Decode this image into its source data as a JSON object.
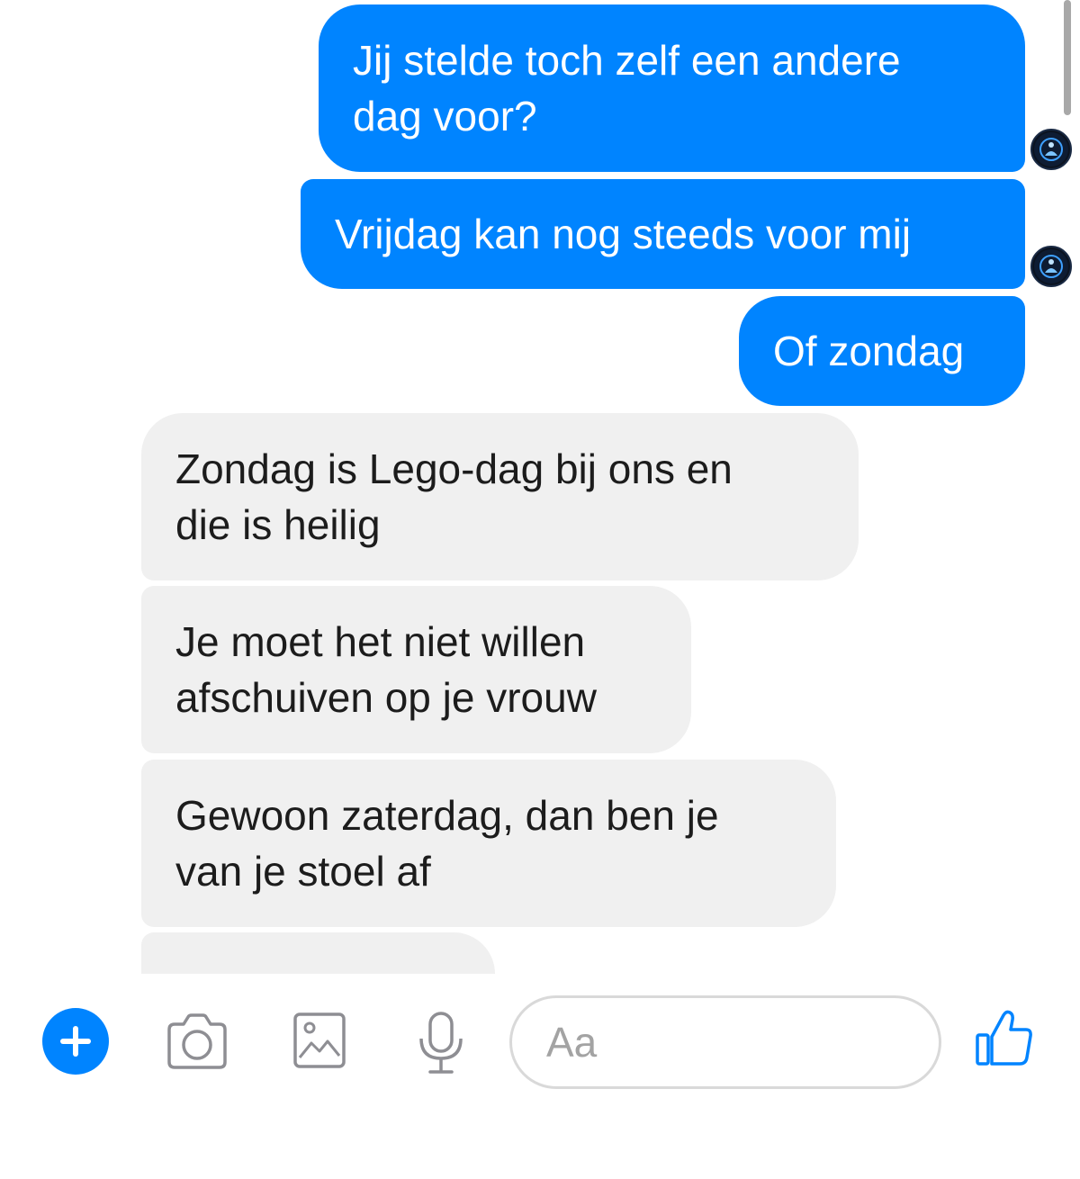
{
  "messages": [
    {
      "direction": "outgoing",
      "text": "Jij stelde toch zelf een andere\ndag voor?"
    },
    {
      "direction": "outgoing",
      "text": "Vrijdag kan nog steeds voor mij"
    },
    {
      "direction": "outgoing",
      "text": "Of zondag"
    },
    {
      "direction": "incoming",
      "text": "Zondag is Lego-dag bij ons en\ndie is heilig"
    },
    {
      "direction": "incoming",
      "text": "Je moet het niet willen\nafschuiven op je vrouw"
    },
    {
      "direction": "incoming",
      "text": "Gewoon zaterdag, dan ben je\nvan je stoel af"
    },
    {
      "direction": "incoming",
      "text": ""
    }
  ],
  "composer": {
    "placeholder": "Aa",
    "icons": [
      "plus-icon",
      "camera-icon",
      "gallery-icon",
      "microphone-icon",
      "thumbs-up-icon"
    ]
  },
  "colors": {
    "outgoing_bubble": "#0084ff",
    "incoming_bubble": "#f0f0f0",
    "accent": "#0084ff"
  }
}
